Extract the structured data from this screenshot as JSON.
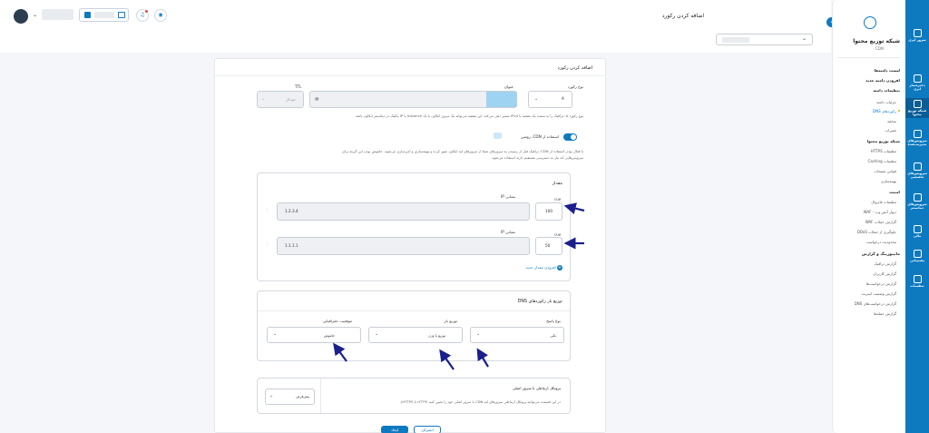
{
  "topbar": {
    "page_title": "اضافه کردن رکورد",
    "domain_select_value": "",
    "top_button_label": "",
    "user_name": ""
  },
  "sidebar_panel": {
    "title": "شبکه توزیع محتوا",
    "subtitle": "CDN",
    "items": [
      {
        "label": "لیست دامنه‌ها",
        "kind": "head"
      },
      {
        "label": "افزودن دامنه جدید",
        "kind": "head"
      },
      {
        "label": "تنظیمات دامنه",
        "kind": "head"
      },
      {
        "label": "جزئیات دامنه",
        "kind": "sub"
      },
      {
        "label": "رکوردهای DNS",
        "kind": "sub-selected"
      },
      {
        "label": "سابقه",
        "kind": "sub"
      },
      {
        "label": "تغییرات",
        "kind": "sub"
      },
      {
        "label": "شبکه توزیع محتوا",
        "kind": "head"
      },
      {
        "label": "تنظیمات HTTPS",
        "kind": "sub"
      },
      {
        "label": "تنظیمات Caching",
        "kind": "sub"
      },
      {
        "label": "قوانین صفحات",
        "kind": "sub"
      },
      {
        "label": "بهینه‌سازی",
        "kind": "sub"
      },
      {
        "label": "امنیت",
        "kind": "head"
      },
      {
        "label": "تنظیمات فایروال",
        "kind": "sub"
      },
      {
        "label": "دیوار آتش وب - WAF",
        "kind": "sub"
      },
      {
        "label": "گزارش حملات WAF",
        "kind": "sub"
      },
      {
        "label": "جلوگیری از حملات DDoS",
        "kind": "sub"
      },
      {
        "label": "محدودیت درخواست",
        "kind": "sub"
      },
      {
        "label": "مانیتورینگ و گزارش",
        "kind": "head"
      },
      {
        "label": "گزارش ترافیک",
        "kind": "sub"
      },
      {
        "label": "گزارش کاربران",
        "kind": "sub"
      },
      {
        "label": "گزارش درخواست‌ها",
        "kind": "sub"
      },
      {
        "label": "گزارش وضعیت اینترنت",
        "kind": "sub"
      },
      {
        "label": "گزارش درخواست‌های DNS",
        "kind": "sub"
      },
      {
        "label": "گزارش حمله‌ها",
        "kind": "sub"
      }
    ]
  },
  "rail": {
    "items": [
      {
        "label": "سرور ابری",
        "icon": "cloud-server-icon"
      },
      {
        "label": "ذخیره‌ساز ابری",
        "icon": "storage-icon"
      },
      {
        "label": "شبکه توزیع محتوا",
        "icon": "cdn-icon"
      },
      {
        "label": "سرویس‌های مدیریت‌شده",
        "icon": "managed-services-icon"
      },
      {
        "label": "سرویس‌های تخصصی",
        "icon": "special-services-icon"
      },
      {
        "label": "سرویس‌های دیتاسنتر",
        "icon": "datacenter-icon"
      },
      {
        "label": "مالی",
        "icon": "finance-icon"
      },
      {
        "label": "پشتیبانی",
        "icon": "support-icon"
      },
      {
        "label": "تنظیمات",
        "icon": "settings-icon"
      }
    ]
  },
  "form": {
    "title": "اضافه کردن رکورد",
    "record_type_label": "نوع رکورد",
    "record_type_value": "A",
    "name_label": "عنوان",
    "name_value": "@",
    "ttl_label": "TTL",
    "ttl_placeholder": "خودکار",
    "record_help": "نوع رکورد A: ترافیک را به سمت یک مقصد با IPv4 مسیر دهی می‌کند. این مقصد می‌تواند یک سرور ابکاون یا یک Instance با IP پابلیک در دیتاسنتر ابکاون باشد.",
    "cdn_toggle_label": "استفاده از CDN، روشن",
    "cdn_help_1": "با فعال بودن استفاده از CDN، ترافیک قبل از رسیدن به سرورهای شما از سرورهای لبه ابکاون عبور کرده و بهینه‌سازی و امن‌سازی می‌شود. خاموش بودن این گزینه برای",
    "cdn_help_2": "سرویس‌هایی که نیاز به دسترسی مستقیم دارند استفاده می‌شود.",
    "value_section_title": "مقدار",
    "ip_label_1": "نشانی IP",
    "weight_label_1": "وزن",
    "ip_value_1": "1.2.3.4",
    "weight_value_1": "100",
    "ip_label_2": "نشانی IP",
    "weight_label_2": "وزن",
    "ip_value_2": "1.1.1.1",
    "weight_value_2": "50",
    "add_value_label": "افزودن مقدار جدید",
    "lb_section_title": "توزیع بار رکوردهای DNS",
    "response_type_label": "نوع پاسخ",
    "response_type_value": "تکی",
    "lb_method_label": "توزیع بار",
    "lb_method_value": "توزیع با وزن",
    "geo_label": "موقعیت جغرافیایی",
    "geo_value": "خاموش",
    "protocol_title": "پروتکل ارتباطی با سرور اصلی",
    "protocol_help": "در این قسمت می‌توانید پروتکل ارتباطی سرورهای لبه CDN با سرور اصلی خود را تعیین کنید (HTTP یا HTTPS).",
    "protocol_value": "پیش‌فرض",
    "submit_label": "ایجاد",
    "cancel_label": "انصراف"
  },
  "colors": {
    "primary": "#0d7ac0",
    "annotation_arrow": "#1a1f8c"
  }
}
